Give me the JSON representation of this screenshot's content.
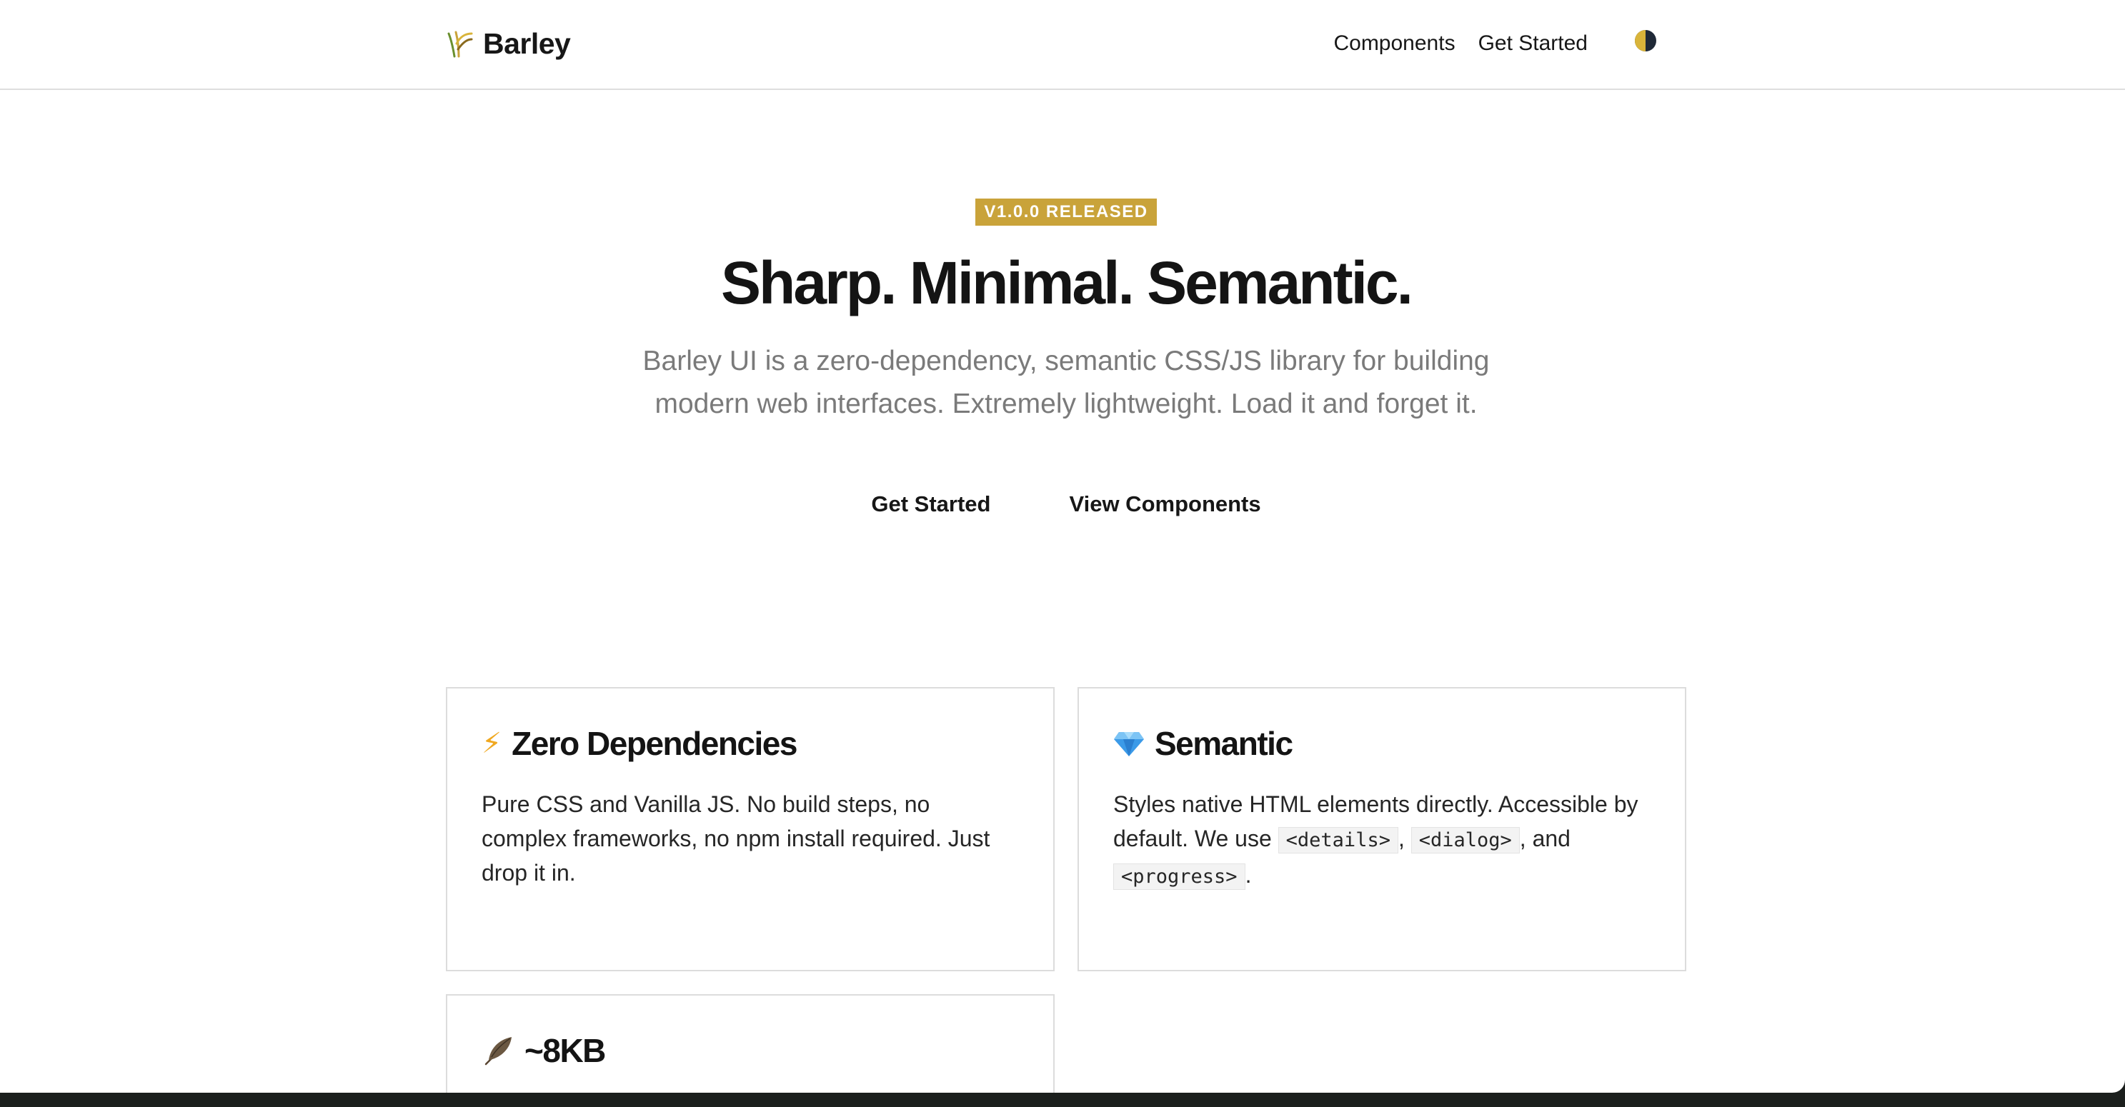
{
  "header": {
    "brand": "Barley",
    "nav": [
      "Components",
      "Get Started"
    ],
    "theme_toggle_icon": "half-moon-icon"
  },
  "hero": {
    "badge": "V1.0.0 RELEASED",
    "title": "Sharp. Minimal. Semantic.",
    "subtitle": "Barley UI is a zero-dependency, semantic CSS/JS library for building modern web interfaces. Extremely lightweight. Load it and forget it.",
    "actions": [
      "Get Started",
      "View Components"
    ]
  },
  "features": [
    {
      "icon": "⚡",
      "title": "Zero Dependencies",
      "body": "Pure CSS and Vanilla JS. No build steps, no complex frameworks, no npm install required. Just drop it in."
    },
    {
      "icon": "gem-icon",
      "title": "Semantic",
      "body_before": "Styles native HTML elements directly. Accessible by default. We use ",
      "code_1": "<details>",
      "sep_1": ", ",
      "code_2": "<dialog>",
      "sep_2": ", and ",
      "code_3": "<progress>",
      "body_after": "."
    },
    {
      "icon": "feather-icon",
      "title": "~8KB"
    }
  ],
  "colors": {
    "badge_bg": "#c9a33a",
    "text": "#171717",
    "muted": "#7a7a7a",
    "border": "#dcdcdc"
  }
}
